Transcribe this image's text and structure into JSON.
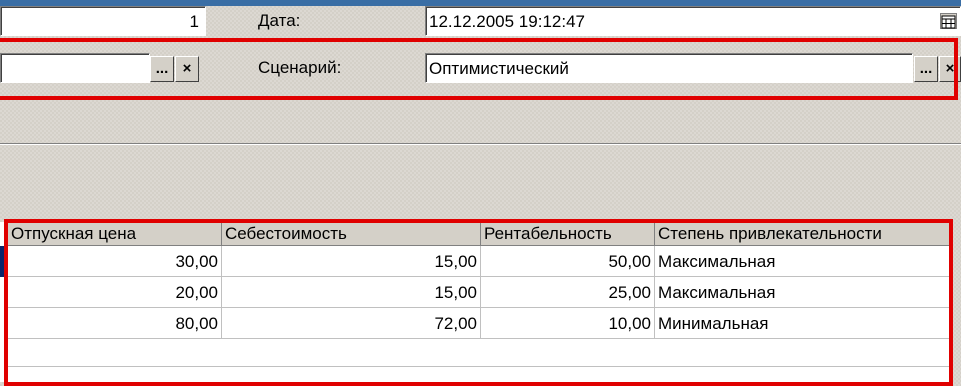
{
  "header": {
    "number_value": "1",
    "date_label": "Дата:",
    "date_value": "12.12.2005 19:12:47",
    "scenario_label": "Сценарий:",
    "scenario_value": "Оптимистический",
    "select_button": "...",
    "clear_button": "×"
  },
  "table": {
    "columns": [
      "Отпускная цена",
      "Себестоимость",
      "Рентабельность",
      "Степень привлекательности"
    ],
    "rows": [
      [
        "30,00",
        "15,00",
        "50,00",
        "Максимальная"
      ],
      [
        "20,00",
        "15,00",
        "25,00",
        "Максимальная"
      ],
      [
        "80,00",
        "72,00",
        "10,00",
        "Минимальная"
      ]
    ]
  },
  "colors": {
    "highlight_frame": "#e00000",
    "window_bg": "#d4d0c8"
  },
  "icons": {
    "calendar": "calendar-icon"
  }
}
